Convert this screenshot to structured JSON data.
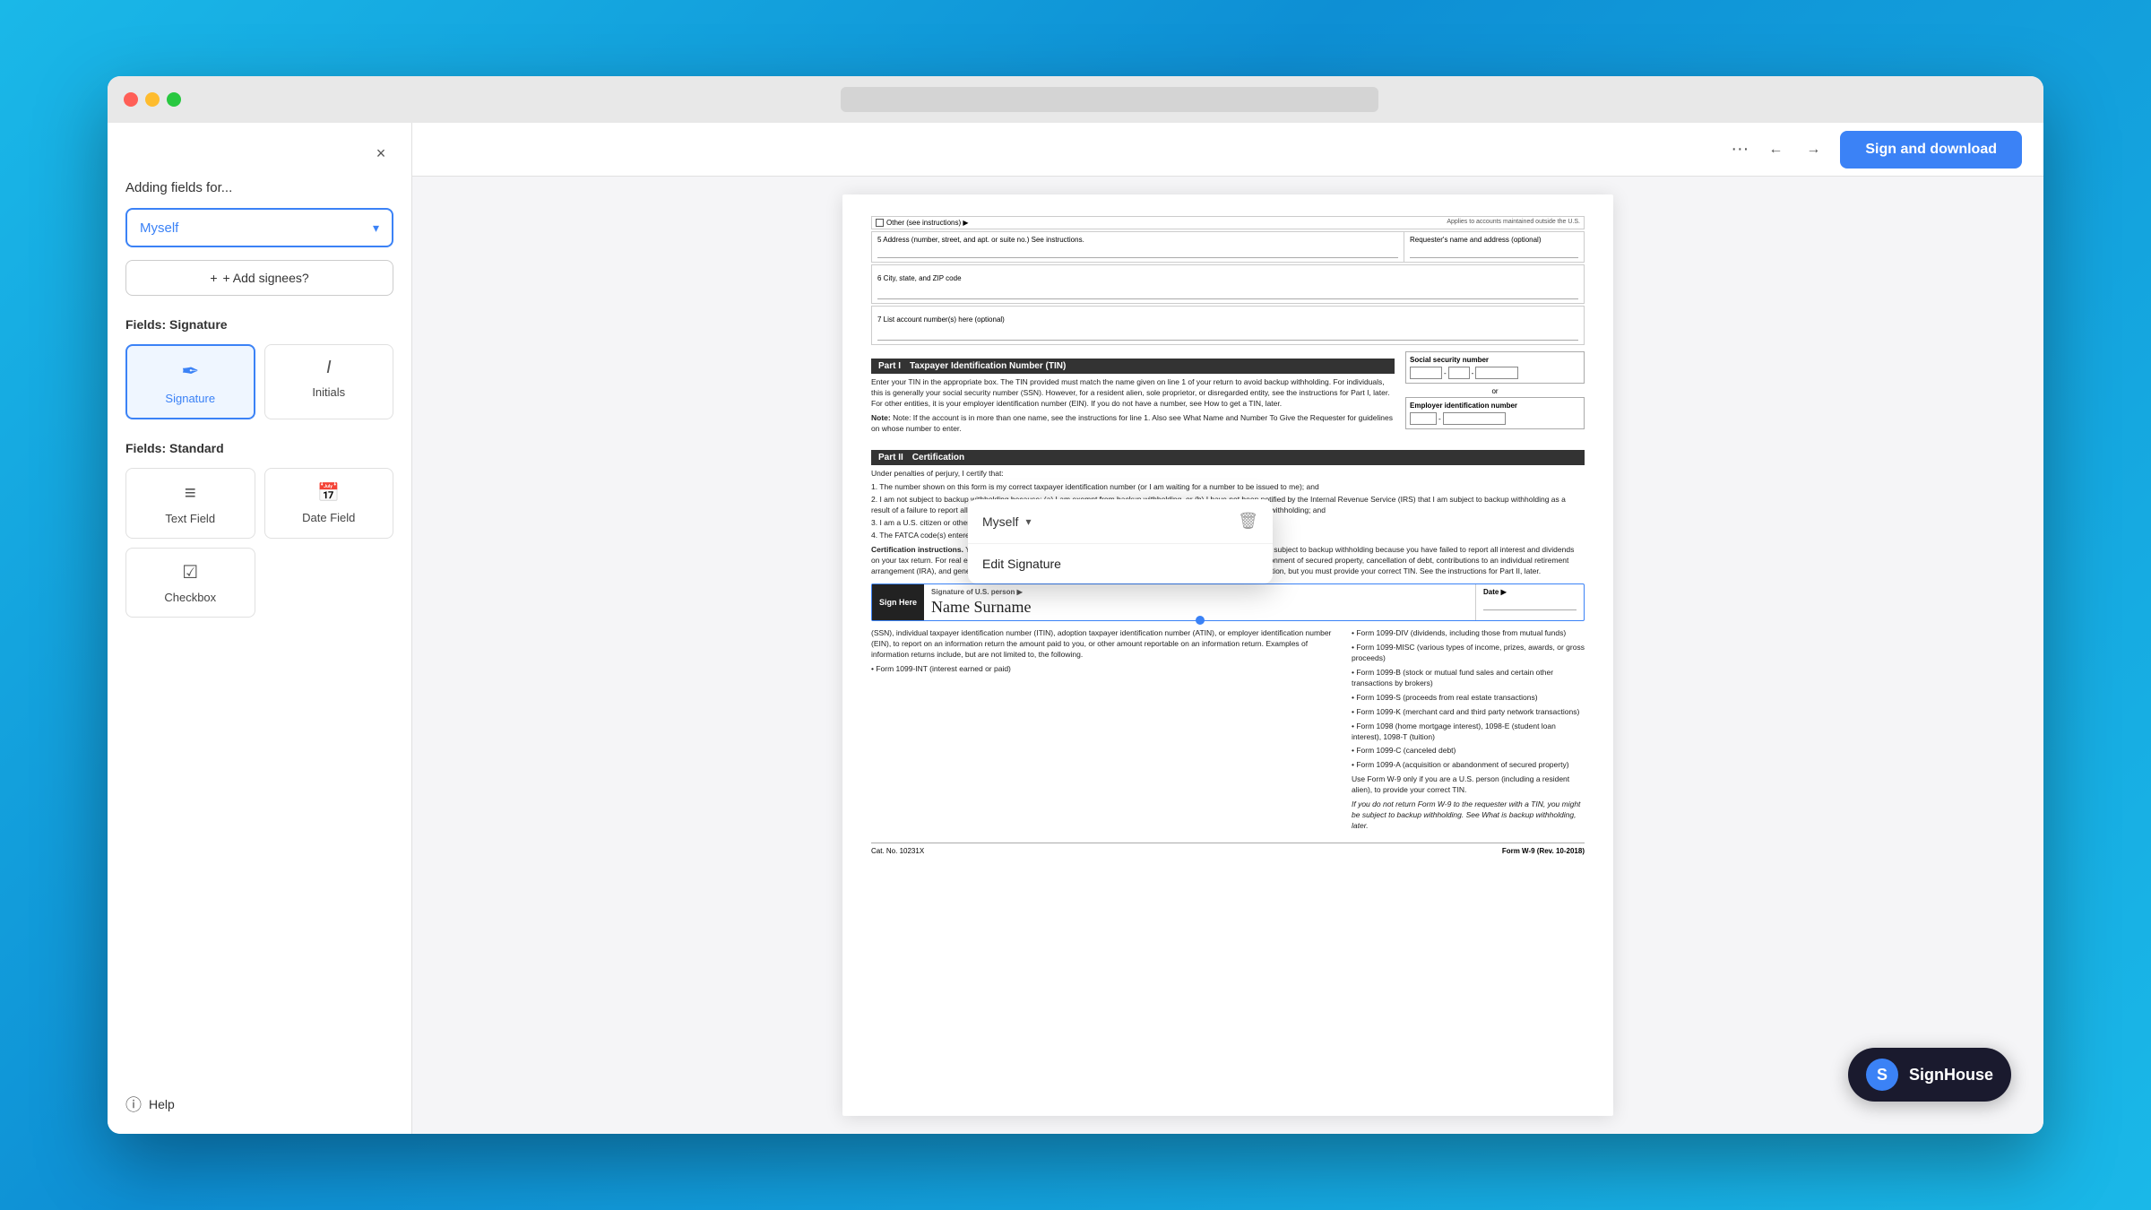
{
  "browser": {
    "url": "",
    "traffic_lights": [
      "close",
      "minimize",
      "maximize"
    ]
  },
  "toolbar": {
    "more_label": "···",
    "back_label": "←",
    "forward_label": "→",
    "sign_download_label": "Sign and download"
  },
  "sidebar": {
    "close_label": "×",
    "adding_fields_label": "Adding fields for...",
    "myself_label": "Myself",
    "add_signees_label": "+ Add signees?",
    "fields_signature_label": "Fields: Signature",
    "fields_standard_label": "Fields: Standard",
    "signature_field_label": "Signature",
    "initials_field_label": "Initials",
    "text_field_label": "Text Field",
    "date_field_label": "Date Field",
    "checkbox_label": "Checkbox",
    "help_label": "Help"
  },
  "popup": {
    "myself_label": "Myself",
    "edit_signature_label": "Edit Signature"
  },
  "document": {
    "other_checkbox_label": "Other (see instructions) ▶",
    "applies_label": "Applies to accounts maintained outside the U.S.",
    "address_number_label": "5 Address (number, street, and apt. or suite no.) See instructions.",
    "requesters_label": "Requester's name and address (optional)",
    "city_label": "6 City, state, and ZIP code",
    "account_label": "7 List account number(s) here (optional)",
    "part1_label": "Part I",
    "part1_title": "Taxpayer Identification Number (TIN)",
    "part1_text": "Enter your TIN in the appropriate box. The TIN provided must match the name given on line 1 of your return to avoid backup withholding. For individuals, this is generally your social security number (SSN). However, for a resident alien, sole proprietor, or disregarded entity, see the instructions for Part I, later. For other entities, it is your employer identification number (EIN). If you do not have a number, see How to get a TIN, later.",
    "part1_note": "Note: If the account is in more than one name, see the instructions for line 1. Also see What Name and Number To Give the Requester for guidelines on whose number to enter.",
    "ssn_label": "Social security number",
    "ein_label": "Employer identification number",
    "part2_label": "Part II",
    "part2_title": "Certification",
    "cert_intro": "Under penalties of perjury, I certify that:",
    "cert_items": [
      "1. The number shown on this form is my correct taxpayer identification number (or I am waiting for a number to be issued to me); and",
      "2. I am not subject to backup withholding because: (a) I am exempt from backup withholding, or (b) I have not been notified by the Internal Revenue Service (IRS) that I am subject to backup withholding as a result of a failure to report all interest or dividends, or (c) the IRS has notified me that I am no longer subject to backup withholding; and",
      "3. I am a U.S. citizen or other U.S. person (defined below); and",
      "4. The FATCA code(s) entered on this form (if any) indicating that I am exempt from FATCA reporting is correct."
    ],
    "cert_instructions": "Certification instructions. You must cross out item 2 above if you have been notified by the IRS that you are currently subject to backup withholding because you have failed to report all interest and dividends on your tax return. For real estate transactions, item 2 does not apply. For mortgage interest paid, acquisition or abandonment of secured property, cancellation of debt, contributions to an individual retirement arrangement (IRA), and generally, payments other than interest and dividends, you are not required to sign the certification, but you must provide your correct TIN. See the instructions for Part II, later.",
    "sign_here_label": "Sign Here",
    "sign_here_sub": "Signature of U.S. person ▶",
    "signature_value": "Name Surname",
    "date_label": "Date ▶",
    "right_column": [
      "• Form 1099-DIV (dividends, including those from mutual funds)",
      "• Form 1099-MISC (various types of income, prizes, awards, or gross proceeds)",
      "• Form 1099-B (stock or mutual fund sales and certain other transactions by brokers)",
      "• Form 1099-S (proceeds from real estate transactions)",
      "• Form 1099-K (merchant card and third party network transactions)",
      "• Form 1098 (home mortgage interest), 1098-E (student loan interest), 1098-T (tuition)",
      "• Form 1099-C (canceled debt)",
      "• Form 1099-A (acquisition or abandonment of secured property)",
      "Use Form W-9 only if you are a U.S. person (including a resident alien), to provide your correct TIN.",
      "If you do not return Form W-9 to the requester with a TIN, you might be subject to backup withholding. See What is backup withholding, later."
    ],
    "bottom_left": [
      "(SSN), individual taxpayer identification number (ITIN), adoption taxpayer identification number (ATIN), or employer identification number (EIN), to report on an information return the amount paid to you, or other amount reportable on an information return. Examples of information returns include, but are not limited to, the following.",
      "• Form 1099-INT (interest earned or paid)"
    ],
    "cat_label": "Cat. No. 10231X",
    "form_label": "Form W-9 (Rev. 10-2018)"
  },
  "signhouse": {
    "icon_label": "S",
    "brand_label": "SignHouse"
  },
  "colors": {
    "primary": "#3b82f6",
    "dark": "#1a1a2e",
    "close_red": "#ff5f57",
    "minimize_yellow": "#febc2e",
    "maximize_green": "#28c840"
  }
}
